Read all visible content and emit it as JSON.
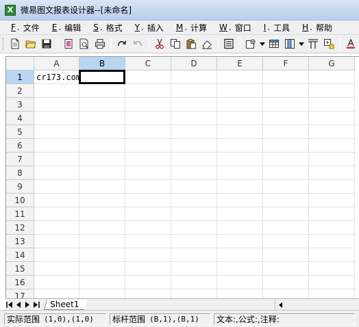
{
  "window": {
    "title": "微易图文报表设计器--[未命名]",
    "app_icon_letter": "X",
    "icon": "spreadsheet-app-icon"
  },
  "menu": [
    {
      "key": "F",
      "label": "文件"
    },
    {
      "key": "E",
      "label": "编辑"
    },
    {
      "key": "S",
      "label": "格式"
    },
    {
      "key": "Y",
      "label": "插入"
    },
    {
      "key": "M",
      "label": "计算"
    },
    {
      "key": "W",
      "label": "窗口"
    },
    {
      "key": "I",
      "label": "工具"
    },
    {
      "key": "H",
      "label": "帮助"
    }
  ],
  "toolbar": {
    "icons": [
      "new-file-icon",
      "open-folder-icon",
      "save-icon",
      "page-setup-icon",
      "print-preview-icon",
      "print-icon",
      "redo-icon",
      "undo-icon",
      "cut-icon",
      "copy-icon",
      "paste-icon",
      "eraser-icon",
      "properties-icon",
      "settings-icon",
      "table-icon",
      "column-icon",
      "border-icon",
      "insert-cell-icon",
      "font-color-icon"
    ]
  },
  "grid": {
    "columns": [
      "A",
      "B",
      "C",
      "D",
      "E",
      "F",
      "G"
    ],
    "rows": [
      "1",
      "2",
      "3",
      "4",
      "5",
      "6",
      "7",
      "8",
      "9",
      "10",
      "11",
      "12",
      "13",
      "14",
      "15",
      "16",
      "17"
    ],
    "active_column": "B",
    "active_row": "1",
    "cells": {
      "A1": "cr173.com"
    }
  },
  "sheets": [
    "Sheet1"
  ],
  "status": {
    "range_label": "实际范围",
    "range_value": "(1,0),(1,0)",
    "anchor_label": "标杆范围",
    "anchor_value": "(B,1),(B,1)",
    "info": "文本:,公式:,注释:"
  },
  "colors": {
    "header_active": "#b8d6f2",
    "title_bar": "#c6d8ee",
    "app_icon": "#2d8a3a"
  }
}
